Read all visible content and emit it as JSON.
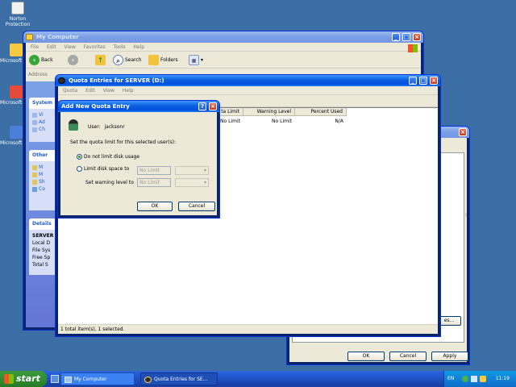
{
  "desktop": {
    "icons": [
      {
        "label": "Norton Protection"
      },
      {
        "label": "Microsoft Office"
      },
      {
        "label": "Microsoft Office"
      },
      {
        "label": "Microsoft Office"
      }
    ]
  },
  "my_computer": {
    "title": "My Computer",
    "menu": [
      "File",
      "Edit",
      "View",
      "Favorites",
      "Tools",
      "Help"
    ],
    "toolbar": {
      "back": "Back",
      "search": "Search",
      "folders": "Folders"
    },
    "address_label": "Address",
    "task_panes": {
      "system": {
        "title": "System"
      },
      "other": {
        "title": "Other"
      },
      "details": {
        "title": "Details",
        "lines": [
          "SERVER",
          "Local D",
          "File Sys",
          "Free Sp",
          "Total S"
        ]
      }
    }
  },
  "quota": {
    "title": "Quota Entries for SERVER (D:)",
    "menu": [
      "Quota",
      "Edit",
      "View",
      "Help"
    ],
    "columns": [
      "ta Limit",
      "Warning Level",
      "Percent Used"
    ],
    "row": {
      "limit": "No Limit",
      "warning": "No Limit",
      "percent": "N/A"
    },
    "status": "1 total item(s), 1 selected."
  },
  "properties": {
    "buttons": {
      "ok": "OK",
      "cancel": "Cancel",
      "apply": "Apply"
    }
  },
  "dialog": {
    "title": "Add New Quota Entry",
    "user_label": "User:",
    "user_name": "jacksonr",
    "instruction": "Set the quota limit for this selected user(s):",
    "opt_no_limit": "Do not limit disk usage",
    "opt_limit": "Limit disk space to",
    "warning_label": "Set warning level to",
    "limit_value": "No Limit",
    "warning_value": "No Limit",
    "ok": "OK",
    "cancel": "Cancel"
  },
  "taskbar": {
    "start": "start",
    "items": [
      "My Computer",
      "Quota Entries for SE..."
    ],
    "lang": "EN",
    "time": "11:19"
  }
}
